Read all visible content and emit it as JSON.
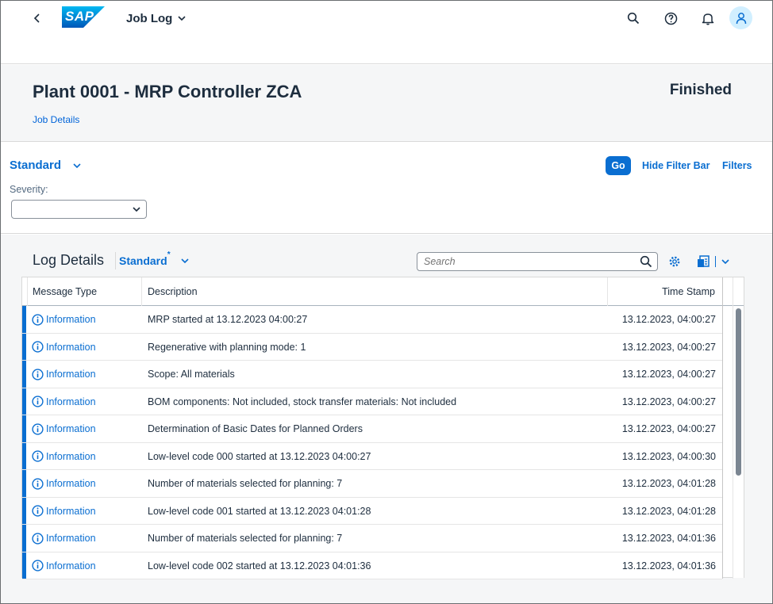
{
  "shell": {
    "logo_text": "SAP",
    "app_title": "Job Log"
  },
  "header": {
    "title": "Plant 0001 - MRP Controller ZCA",
    "status": "Finished",
    "link": "Job Details"
  },
  "filter_bar": {
    "variant": "Standard",
    "severity_label": "Severity:",
    "severity_value": "",
    "go_label": "Go",
    "hide_label": "Hide Filter Bar",
    "filters_label": "Filters"
  },
  "log": {
    "title": "Log Details",
    "variant": "Standard",
    "variant_modified": "*",
    "search_placeholder": "Search",
    "columns": [
      "Message Type",
      "Description",
      "Time Stamp"
    ],
    "rows": [
      {
        "type": "Information",
        "description": "MRP started at 13.12.2023 04:00:27",
        "timestamp": "13.12.2023, 04:00:27"
      },
      {
        "type": "Information",
        "description": "Regenerative with planning mode: 1",
        "timestamp": "13.12.2023, 04:00:27"
      },
      {
        "type": "Information",
        "description": "Scope: All materials",
        "timestamp": "13.12.2023, 04:00:27"
      },
      {
        "type": "Information",
        "description": "BOM components: Not included, stock transfer materials: Not included",
        "timestamp": "13.12.2023, 04:00:27"
      },
      {
        "type": "Information",
        "description": "Determination of Basic Dates for Planned Orders",
        "timestamp": "13.12.2023, 04:00:27"
      },
      {
        "type": "Information",
        "description": "Low-level code 000 started at 13.12.2023 04:00:27",
        "timestamp": "13.12.2023, 04:00:30"
      },
      {
        "type": "Information",
        "description": "Number of materials selected for planning: 7",
        "timestamp": "13.12.2023, 04:01:28"
      },
      {
        "type": "Information",
        "description": "Low-level code 001 started at 13.12.2023 04:01:28",
        "timestamp": "13.12.2023, 04:01:28"
      },
      {
        "type": "Information",
        "description": "Number of materials selected for planning: 7",
        "timestamp": "13.12.2023, 04:01:36"
      },
      {
        "type": "Information",
        "description": "Low-level code 002 started at 13.12.2023 04:01:36",
        "timestamp": "13.12.2023, 04:01:36"
      }
    ]
  },
  "colors": {
    "brand": "#0a6ed1",
    "link": "#0064d9",
    "info_bar": "#0a6ed1"
  },
  "icons": {
    "back": "chevron-left-icon",
    "title_dropdown": "chevron-down-icon",
    "search": "search-icon",
    "help": "help-icon",
    "notifications": "bell-icon",
    "profile": "user-icon",
    "settings": "gear-icon",
    "export": "export-spreadsheet-icon",
    "info": "information-icon"
  }
}
